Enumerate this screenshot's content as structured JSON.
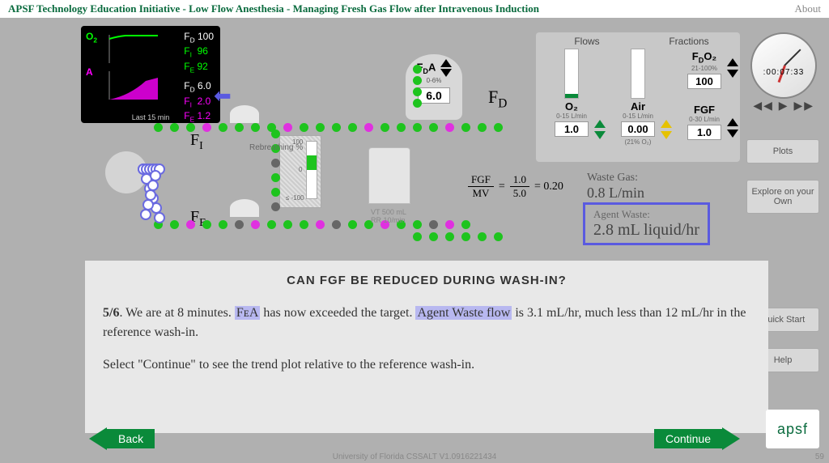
{
  "header": {
    "title": "APSF Technology Education Initiative - Low Flow Anesthesia - Managing Fresh Gas Flow after Intravenous Induction",
    "about": "About"
  },
  "monitor": {
    "o2": {
      "fd": "100",
      "fi": "96",
      "fe": "92"
    },
    "agent": {
      "fd": "6.0",
      "fi": "2.0",
      "fe": "1.2"
    },
    "footer": "Last 15 min"
  },
  "fda": {
    "label": "F",
    "sub": "D",
    "suffix": "A",
    "range": "0-6%",
    "value": "6.0"
  },
  "labels": {
    "fd": "F",
    "fd_sub": "D",
    "fi": "F",
    "fi_sub": "I",
    "fe": "F",
    "fe_sub": "E"
  },
  "controls": {
    "hdr_flows": "Flows",
    "hdr_fractions": "Fractions",
    "o2": {
      "label": "O₂",
      "range": "0-15 L/min",
      "value": "1.0",
      "fill": 8
    },
    "air": {
      "label": "Air",
      "range": "0-15 L/min",
      "value": "0.00",
      "sub": "(21% O₂)",
      "fill": 0
    },
    "fdo2": {
      "label": "F",
      "sub": "D",
      "suffix": "O₂",
      "range": "21-100%",
      "value": "100"
    },
    "fgf": {
      "label": "FGF",
      "range": "0-30 L/min",
      "value": "1.0"
    }
  },
  "clock": {
    "time": ":00:07:33"
  },
  "rebreathing": {
    "label": "Rebreathing %",
    "top": "100",
    "mid": "0",
    "bot": "≤ -100"
  },
  "vt_rr": {
    "vt": "VT 500 mL",
    "rr": "RR 10/min"
  },
  "equation": {
    "lhs_n": "FGF",
    "lhs_d": "MV",
    "rhs_n": "1.0",
    "rhs_d": "5.0",
    "result": "0.20"
  },
  "waste": {
    "label": "Waste Gas:",
    "value": "0.8 L/min"
  },
  "agent_waste": {
    "label": "Agent Waste:",
    "value": "2.8 mL liquid/hr"
  },
  "side": {
    "plots": "Plots",
    "explore": "Explore on your Own",
    "quick": "Quick Start",
    "help": "Help"
  },
  "text": {
    "heading": "CAN FGF BE REDUCED DURING WASH-IN?",
    "step": "5/6",
    "line1a": ". We are at 8 minutes. ",
    "hl1": "FᴇA",
    "line1b": " has now exceeded the target.  ",
    "hl2": "Agent Waste flow",
    "line1c": " is 3.1 mL/hr, much less than 12 mL/hr in the reference wash-in.",
    "line2": "Select \"Continue\" to see the trend plot relative to the reference wash-in."
  },
  "nav": {
    "back": "Back",
    "continue": "Continue"
  },
  "footer": "University of Florida CSSALT V1.0916221434",
  "page": "59",
  "logo": "apsf"
}
